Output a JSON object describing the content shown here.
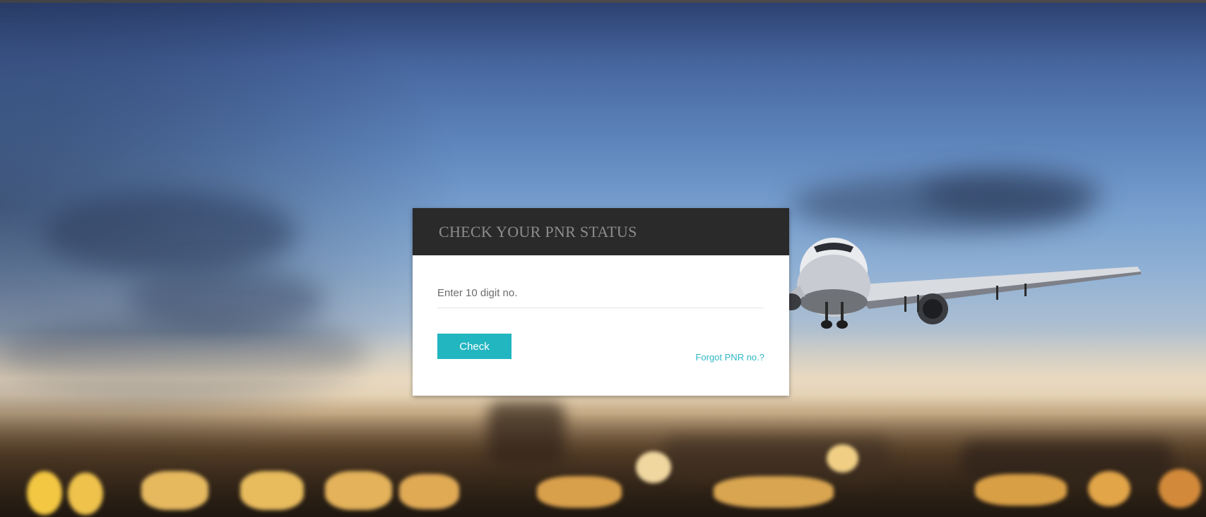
{
  "dialog": {
    "title": "CHECK YOUR PNR STATUS",
    "input_placeholder": "Enter 10 digit no.",
    "input_value": "",
    "check_label": "Check",
    "forgot_label": "Forgot PNR no.?"
  },
  "colors": {
    "accent": "#22b6c1",
    "header_bg": "#2a2a2a",
    "link": "#2fb8c8"
  },
  "background": {
    "icon": "airplane-icon"
  }
}
